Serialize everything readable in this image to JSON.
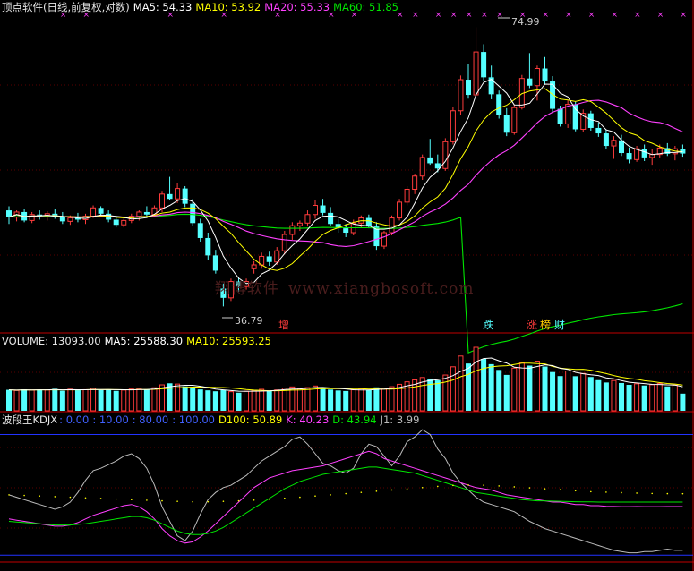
{
  "header": {
    "title": "顶点软件(日线,前复权,对数)",
    "ma5": "MA5: 54.33",
    "ma10": "MA10: 53.92",
    "ma20": "MA20: 55.33",
    "ma60": "MA60: 51.85"
  },
  "volume_header": {
    "label": "VOLUME: 13093.00",
    "ma5": "MA5: 25588.30",
    "ma10": "MA10: 25593.25"
  },
  "indicator_header": {
    "name": "波段王KDJX",
    "l1": ": 0.00",
    "l2": ": 10.00",
    "l3": ": 80.00",
    "l4": ": 100.00",
    "d100": "D100: 50.89",
    "k": "K: 40.23",
    "d": "D: 43.94",
    "j1": "J1: 3.99"
  },
  "watermark": {
    "cn": "翔博软件",
    "url": "www.xiangbosoft.com"
  },
  "annotations": {
    "high": "74.99",
    "low": "36.79"
  },
  "markers": {
    "zeng": "增",
    "die": "跌",
    "zhang": "涨",
    "bang": "榜",
    "cai": "财"
  },
  "colors": {
    "up": "#ff3c3c",
    "down": "#54ffff",
    "ma5": "#ffffff",
    "ma10": "#ffff00",
    "ma20": "#ff40ff",
    "ma60": "#00e600",
    "axis": "#c00000",
    "magenta": "#ff40ff"
  },
  "chart_data": [
    {
      "type": "candlestick",
      "title": "顶点软件(日线,前复权,对数)",
      "annotations": [
        {
          "label": "74.99",
          "kind": "high"
        },
        {
          "label": "36.79",
          "kind": "low"
        }
      ],
      "ohlc": [
        [
          47.0,
          47.5,
          45.4,
          46.2
        ],
        [
          46.2,
          47.0,
          45.7,
          46.8
        ],
        [
          46.8,
          47.2,
          45.6,
          45.8
        ],
        [
          45.8,
          46.8,
          45.5,
          46.5
        ],
        [
          46.5,
          47.0,
          45.9,
          46.4
        ],
        [
          46.4,
          46.9,
          45.8,
          46.6
        ],
        [
          46.6,
          47.2,
          46.0,
          46.2
        ],
        [
          46.2,
          46.8,
          45.4,
          45.7
        ],
        [
          45.7,
          46.4,
          45.3,
          46.1
        ],
        [
          46.1,
          46.7,
          45.6,
          45.9
        ],
        [
          45.9,
          46.6,
          45.4,
          46.3
        ],
        [
          46.3,
          47.6,
          46.1,
          47.3
        ],
        [
          47.3,
          47.5,
          46.3,
          46.6
        ],
        [
          46.6,
          47.0,
          45.6,
          45.9
        ],
        [
          45.9,
          46.3,
          45.0,
          45.3
        ],
        [
          45.3,
          46.0,
          45.0,
          45.8
        ],
        [
          45.8,
          46.6,
          45.5,
          46.3
        ],
        [
          46.3,
          47.0,
          45.8,
          46.8
        ],
        [
          46.8,
          47.5,
          46.2,
          46.5
        ],
        [
          46.5,
          47.6,
          46.2,
          47.3
        ],
        [
          47.3,
          49.4,
          46.8,
          49.0
        ],
        [
          49.0,
          51.2,
          48.2,
          48.4
        ],
        [
          48.4,
          50.4,
          47.9,
          49.7
        ],
        [
          49.7,
          50.0,
          47.4,
          47.8
        ],
        [
          47.8,
          48.4,
          45.2,
          45.5
        ],
        [
          45.5,
          46.0,
          43.4,
          43.8
        ],
        [
          43.8,
          44.4,
          41.4,
          41.9
        ],
        [
          41.9,
          42.5,
          40.0,
          40.3
        ],
        [
          38.5,
          39.0,
          36.79,
          37.6
        ],
        [
          37.6,
          39.5,
          37.3,
          39.2
        ],
        [
          39.2,
          39.6,
          38.2,
          38.7
        ],
        [
          38.7,
          39.5,
          38.4,
          39.2
        ],
        [
          40.5,
          41.3,
          40.0,
          40.9
        ],
        [
          40.9,
          42.2,
          40.5,
          41.8
        ],
        [
          41.8,
          42.3,
          40.8,
          41.2
        ],
        [
          41.2,
          42.8,
          40.9,
          42.4
        ],
        [
          42.4,
          44.6,
          42.0,
          44.2
        ],
        [
          44.2,
          45.6,
          43.6,
          45.2
        ],
        [
          45.2,
          45.8,
          44.6,
          45.5
        ],
        [
          45.5,
          47.0,
          45.1,
          46.5
        ],
        [
          46.5,
          48.2,
          46.0,
          47.6
        ],
        [
          47.6,
          48.4,
          46.4,
          46.7
        ],
        [
          46.7,
          47.4,
          45.2,
          45.4
        ],
        [
          45.4,
          46.0,
          44.4,
          44.9
        ],
        [
          44.9,
          45.4,
          43.9,
          44.4
        ],
        [
          44.4,
          45.9,
          44.1,
          45.5
        ],
        [
          45.5,
          46.4,
          45.0,
          46.1
        ],
        [
          46.1,
          46.5,
          44.9,
          45.1
        ],
        [
          45.1,
          45.6,
          42.5,
          42.9
        ],
        [
          42.9,
          44.6,
          42.6,
          44.4
        ],
        [
          44.4,
          46.4,
          44.1,
          46.1
        ],
        [
          46.1,
          48.4,
          45.8,
          48.0
        ],
        [
          48.0,
          50.0,
          47.6,
          49.6
        ],
        [
          49.6,
          51.6,
          49.0,
          51.3
        ],
        [
          51.3,
          54.2,
          50.8,
          53.8
        ],
        [
          53.8,
          56.4,
          52.8,
          53.0
        ],
        [
          53.0,
          54.2,
          51.8,
          52.3
        ],
        [
          52.3,
          56.5,
          52.0,
          56.0
        ],
        [
          56.0,
          61.2,
          55.6,
          60.6
        ],
        [
          60.6,
          66.3,
          60.0,
          65.6
        ],
        [
          65.6,
          68.2,
          62.5,
          63.1
        ],
        [
          63.1,
          74.99,
          62.8,
          70.4
        ],
        [
          70.4,
          71.8,
          65.4,
          66.0
        ],
        [
          66.0,
          68.0,
          62.4,
          63.2
        ],
        [
          63.2,
          63.8,
          59.4,
          60.0
        ],
        [
          60.0,
          61.0,
          56.8,
          57.3
        ],
        [
          57.3,
          61.6,
          57.0,
          61.1
        ],
        [
          61.1,
          66.4,
          60.8,
          65.8
        ],
        [
          65.8,
          70.2,
          64.2,
          64.6
        ],
        [
          64.6,
          68.0,
          62.2,
          67.5
        ],
        [
          67.5,
          69.5,
          64.8,
          65.3
        ],
        [
          65.3,
          66.2,
          60.4,
          60.9
        ],
        [
          60.9,
          61.4,
          58.2,
          58.6
        ],
        [
          58.6,
          62.2,
          58.0,
          61.6
        ],
        [
          61.6,
          62.0,
          57.5,
          57.8
        ],
        [
          57.8,
          60.8,
          57.4,
          60.2
        ],
        [
          60.2,
          60.6,
          57.6,
          58.0
        ],
        [
          58.0,
          58.8,
          56.7,
          57.2
        ],
        [
          57.2,
          57.8,
          55.0,
          55.4
        ],
        [
          55.4,
          56.8,
          53.6,
          56.2
        ],
        [
          56.2,
          57.0,
          54.0,
          54.4
        ],
        [
          54.4,
          55.2,
          53.0,
          53.5
        ],
        [
          53.5,
          55.4,
          53.2,
          55.0
        ],
        [
          55.0,
          55.6,
          53.3,
          53.8
        ],
        [
          53.8,
          55.0,
          52.8,
          54.2
        ],
        [
          54.2,
          55.6,
          53.8,
          55.1
        ],
        [
          55.1,
          55.8,
          54.0,
          54.3
        ],
        [
          54.3,
          55.4,
          53.4,
          55.0
        ],
        [
          55.0,
          55.6,
          53.9,
          54.33
        ]
      ],
      "series": [
        {
          "name": "MA5",
          "color": "#ffffff"
        },
        {
          "name": "MA10",
          "color": "#ffff00"
        },
        {
          "name": "MA20",
          "color": "#ff40ff"
        },
        {
          "name": "MA60",
          "color": "#00e600"
        }
      ]
    },
    {
      "type": "bar",
      "title": "VOLUME",
      "values": [
        16000,
        15500,
        16400,
        15800,
        16200,
        15900,
        16800,
        15300,
        16500,
        15700,
        16100,
        17200,
        15900,
        16300,
        15200,
        15800,
        16600,
        17100,
        16400,
        17600,
        19800,
        21000,
        20400,
        18600,
        17400,
        16300,
        15600,
        14900,
        15800,
        14600,
        13800,
        14900,
        15600,
        16400,
        15300,
        15900,
        17300,
        18200,
        16800,
        17700,
        18900,
        17500,
        16200,
        15500,
        15100,
        16000,
        16800,
        15700,
        17900,
        16600,
        18400,
        20200,
        22100,
        23600,
        25400,
        24600,
        23200,
        27300,
        33600,
        41800,
        36100,
        48500,
        39600,
        35600,
        31200,
        27400,
        32600,
        36800,
        34500,
        37900,
        33800,
        29600,
        26500,
        30400,
        26400,
        28500,
        25800,
        23400,
        21600,
        23100,
        21200,
        19800,
        20600,
        19300,
        19900,
        20800,
        18600,
        19600,
        13093
      ],
      "series": [
        {
          "name": "MA5",
          "color": "#ffffff"
        },
        {
          "name": "MA10",
          "color": "#ffff00"
        }
      ],
      "levels": [
        0,
        25000,
        50000
      ]
    },
    {
      "type": "line",
      "title": "波段王KDJX",
      "ylim": [
        -5,
        110
      ],
      "levels": [
        0,
        10,
        80,
        100
      ],
      "series": [
        {
          "name": "J1",
          "color": "#bbbbbb",
          "values": [
            50,
            48,
            46,
            44,
            42,
            40,
            38,
            40,
            44,
            52,
            62,
            70,
            72,
            75,
            78,
            82,
            84,
            80,
            72,
            58,
            40,
            28,
            16,
            12,
            20,
            34,
            46,
            52,
            56,
            58,
            62,
            66,
            72,
            78,
            82,
            86,
            90,
            96,
            98,
            92,
            84,
            76,
            74,
            70,
            68,
            72,
            84,
            92,
            90,
            82,
            74,
            82,
            94,
            98,
            104,
            100,
            88,
            80,
            68,
            60,
            54,
            48,
            44,
            42,
            40,
            38,
            36,
            32,
            28,
            25,
            22,
            20,
            18,
            16,
            14,
            12,
            10,
            8,
            6,
            4,
            3,
            2,
            2,
            3,
            3,
            4,
            5,
            4,
            3.99
          ]
        },
        {
          "name": "K",
          "color": "#ff40ff",
          "values": [
            30,
            29,
            28,
            27,
            26,
            25,
            24,
            24,
            25,
            27,
            30,
            33,
            35,
            37,
            39,
            41,
            42,
            40,
            36,
            30,
            22,
            16,
            12,
            10,
            11,
            15,
            20,
            26,
            32,
            38,
            44,
            50,
            56,
            60,
            64,
            66,
            68,
            70,
            71,
            72,
            73,
            74,
            76,
            78,
            80,
            82,
            84,
            86,
            84,
            80,
            78,
            76,
            74,
            72,
            70,
            68,
            66,
            64,
            62,
            60,
            58,
            56,
            55,
            54,
            52,
            50,
            49,
            48,
            47,
            46,
            45,
            44,
            44,
            43,
            42,
            42,
            41,
            41,
            40.5,
            40.3,
            40.2,
            40.2,
            40.23,
            40.2,
            40.2,
            40.2,
            40.23,
            40.23,
            40.23
          ]
        },
        {
          "name": "D",
          "color": "#00e600",
          "values": [
            28,
            27.5,
            27,
            26.5,
            26,
            25.5,
            25,
            25,
            25,
            25.5,
            26,
            27,
            28,
            29,
            30,
            31,
            32,
            32,
            31,
            29,
            26,
            23,
            20,
            18,
            17,
            17,
            18,
            20,
            23,
            27,
            31,
            35,
            39,
            43,
            47,
            51,
            55,
            58,
            61,
            63,
            65,
            67,
            68,
            69,
            70,
            71,
            72,
            73,
            73,
            72,
            71,
            70,
            69,
            68,
            66,
            64,
            62,
            60,
            58,
            56,
            54,
            52,
            51,
            50,
            49,
            48,
            47,
            46,
            45.5,
            45,
            45,
            44.8,
            44.6,
            44.4,
            44.3,
            44.2,
            44.1,
            44,
            44,
            43.98,
            43.96,
            43.95,
            43.94,
            43.94,
            43.94,
            43.94,
            43.94,
            43.94,
            43.94
          ]
        },
        {
          "name": "D100",
          "color": "#ffff00",
          "values": [
            50,
            49.8,
            49.5,
            49.2,
            49,
            48.8,
            48.5,
            48.2,
            48,
            47.8,
            47.5,
            47.2,
            47,
            46.8,
            46.5,
            46.2,
            46,
            45.8,
            45.5,
            45.2,
            45,
            44.8,
            44.6,
            44.4,
            44.2,
            44,
            44.2,
            44.4,
            44.6,
            44.8,
            45,
            45.3,
            45.6,
            46,
            46.4,
            46.8,
            47.2,
            47.6,
            48,
            48.5,
            49,
            49.5,
            50,
            50.5,
            51,
            51.5,
            52,
            52.5,
            53,
            53.5,
            54,
            54.5,
            55,
            55.5,
            56,
            56.5,
            57,
            57.4,
            57.8,
            58,
            58.2,
            58.2,
            58,
            57.8,
            57.4,
            57,
            56.6,
            56.2,
            55.8,
            55.4,
            55,
            54.6,
            54.2,
            53.8,
            53.4,
            53,
            52.6,
            52.4,
            52.2,
            52,
            51.8,
            51.6,
            51.4,
            51.2,
            51.1,
            51,
            50.95,
            50.9,
            50.89
          ]
        }
      ]
    }
  ]
}
